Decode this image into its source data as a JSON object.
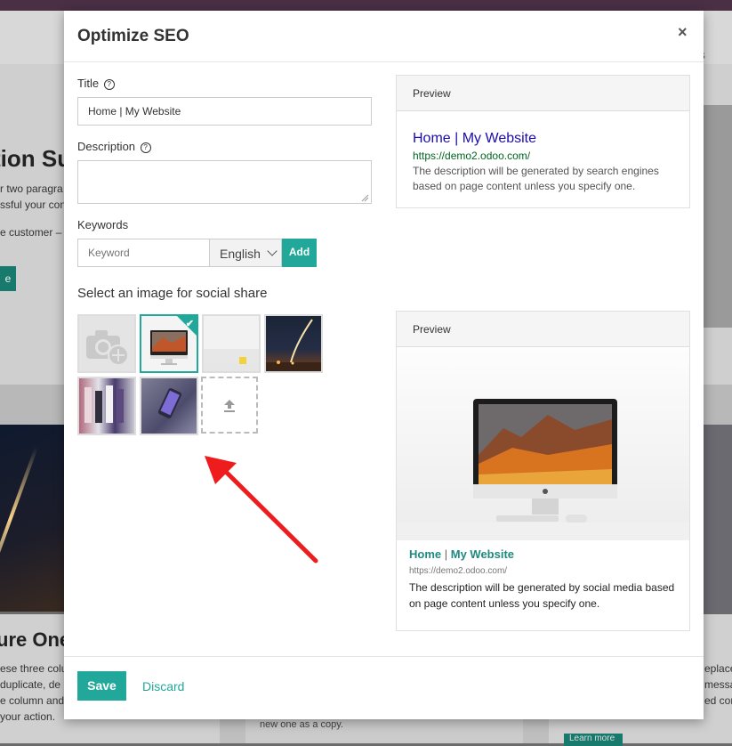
{
  "background": {
    "nav_partial": "us",
    "heading1": "tion Su",
    "text1_line1": "r two paragra",
    "text1_line2": "ssful your con",
    "text1b": "e customer –",
    "button1": "e",
    "heading2": "ure One",
    "text2_lines": [
      "ese three colu",
      "duplicate, de",
      "e column and",
      "your action."
    ],
    "card_text": "new one as a copy.",
    "right_text_lines": [
      "eplace",
      "messa",
      "ed corr"
    ],
    "button2": "Learn more"
  },
  "modal": {
    "title": "Optimize SEO",
    "close_label": "×",
    "title_label": "Title",
    "title_value": "Home | My Website",
    "description_label": "Description",
    "description_value": "",
    "keywords_label": "Keywords",
    "keyword_placeholder": "Keyword",
    "language_selected": "English",
    "add_label": "Add",
    "social_label": "Select an image for social share",
    "help_glyph": "?"
  },
  "google_preview": {
    "header": "Preview",
    "title": "Home | My Website",
    "url": "https://demo2.odoo.com/",
    "description": "The description will be generated by search engines based on page content unless you specify one."
  },
  "social_preview": {
    "header": "Preview",
    "title_part1": "Home",
    "title_sep": " | ",
    "title_part2": "My Website",
    "url": "https://demo2.odoo.com/",
    "description": "The description will be generated by social media based on page content unless you specify one."
  },
  "footer": {
    "save_label": "Save",
    "discard_label": "Discard"
  },
  "colors": {
    "accent": "#21a89a",
    "google_title": "#1a0dab",
    "google_url": "#006621",
    "arrow": "#ee1c1c"
  }
}
